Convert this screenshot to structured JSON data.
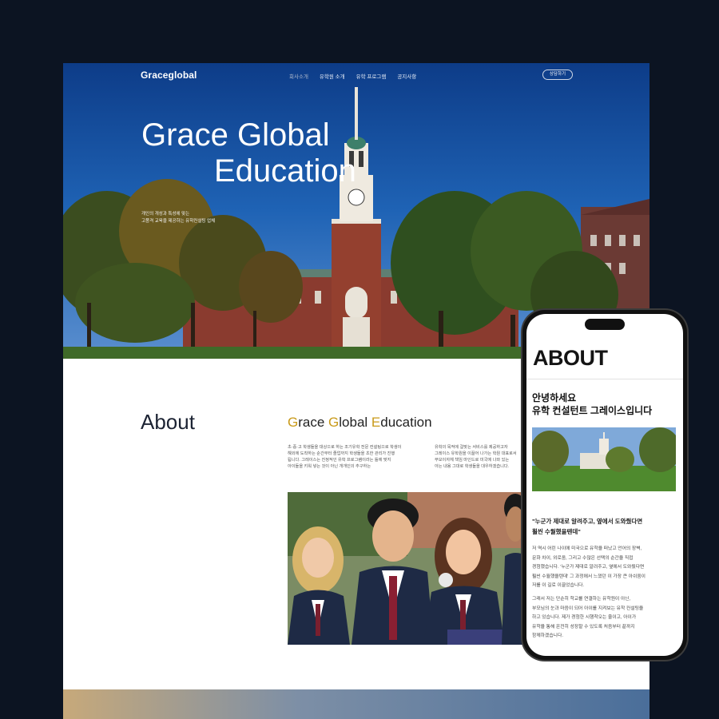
{
  "nav": {
    "logo": "Graceglobal",
    "links": [
      "회사소개",
      "유학원 소개",
      "유학 프로그램",
      "공지사항"
    ],
    "consult_button": "상담하기"
  },
  "hero": {
    "title_line1": "Grace Global",
    "title_line2": "Education",
    "sub_line1": "개인의 개성과 특성에 맞는",
    "sub_line2": "고품격 교육을 제공하는 유학컨설팅 업체"
  },
  "about": {
    "heading": "About",
    "brand": {
      "g1": "G",
      "r1": "race ",
      "g2": "G",
      "r2": "lobal ",
      "g3": "E",
      "r3": "ducation"
    },
    "col1": [
      "초·중·고 학생들을 대상으로 하는 조기유학 전문 컨설팅으로 학생이",
      "해외에 도착하는 순간부터 졸업까지 학생들을 초한 관리가 진행",
      "됩니다. 그레이스는 진정적인 유학 프로그램이라는 틀에 맞지",
      "아이들을 키워 넣는 것이 아닌 개개인의 추구하는"
    ],
    "col2": [
      "유학의 목적에 걸맞는 서비스를 제공하고자",
      "그레이스 유학원을 이끌어 나가는 학원 대표로서",
      "부모이자체 책임 마인드로 미국에 나와 있는",
      "아는 내용 그대로 학생들을 대우하겠습니다."
    ]
  },
  "mobile": {
    "heading": "ABOUT",
    "greeting_line1": "안녕하세요",
    "greeting_line2": "유학 컨설턴트 그레이스입니다",
    "quote_line1": "\"누군가 제대로 알려주고, 옆에서 도와줬다면",
    "quote_line2": "훨씬 수월했을텐데\"",
    "p1": [
      "저 역시 어린 나이에 미국으로 유학을 떠났고 언어의 장벽,",
      "문화 차이, 외로움, 그리고 수많은 선택의 순간을 직접",
      "경험했습니다. '누군가 제대로 알려주고, 옆에서 도와줬다면",
      "훨씬 수월했을텐데' 그 과정에서 느꼈던 이 가장 큰 아쉬움이",
      "저를 이 길로 이끌었습니다."
    ],
    "p2": [
      "그래서 저는 단순히 학교를 연결하는 유학원이 아닌,",
      "부모님의 눈과 마음이 되어 아이를 지켜보는 유학 컨설팅을",
      "하고 있습니다. 제가 경험한 시행착오는 줄이고, 아이가",
      "유학을 통해 온전히 성장할 수 있도록 처음부터 끝까지",
      "함께하겠습니다."
    ]
  },
  "colors": {
    "accent_gold": "#c99a1a",
    "dark_bg": "#0c1422"
  }
}
